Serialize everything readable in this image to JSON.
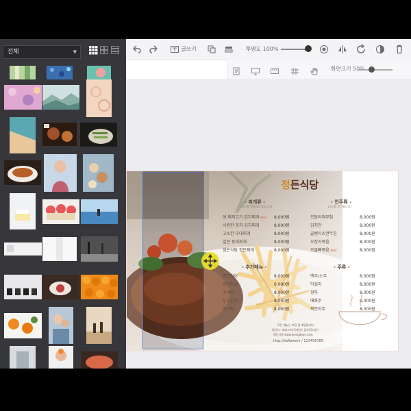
{
  "left_panel": {
    "category": "전체",
    "colors": {
      "panel_bg": "#37373b",
      "select_bg": "#28282c"
    }
  },
  "toolbar": {
    "text_label": "글쓰기",
    "opacity_label": "투명도 100%",
    "opacity_value": 100
  },
  "toolbar2": {
    "zoom_label": "화면크기 50%",
    "zoom_value": 50
  },
  "menu": {
    "title_first": "정",
    "title_rest": "든식당",
    "sections": [
      {
        "title": "- 찌개류 -",
        "subtitle": "(공기밥 포함되어 있습니다)",
        "items": [
          {
            "name": "생 돼지고기 김치찌개",
            "tag": "Best",
            "price": "8,000원"
          },
          {
            "name": "시원한 꽁치 김치찌개",
            "tag": "",
            "price": "8,000원"
          },
          {
            "name": "고소한 부대찌개",
            "tag": "",
            "price": "8,000원"
          },
          {
            "name": "얼큰 동태찌개",
            "tag": "",
            "price": "8,000원"
          },
          {
            "name": "정든식당 정든찌개",
            "tag": "",
            "price": "8,000원"
          }
        ]
      },
      {
        "title": "- 안주류 -",
        "subtitle": "(공기밥 추가됩니다)",
        "items": [
          {
            "name": "모둠야채부침",
            "tag": "",
            "price": "8,000원"
          },
          {
            "name": "김치전",
            "tag": "",
            "price": "8,000원"
          },
          {
            "name": "골뱅이소면무침",
            "tag": "",
            "price": "8,000원"
          },
          {
            "name": "오징어볶음",
            "tag": "",
            "price": "8,000원"
          },
          {
            "name": "오돌뼈볶음",
            "tag": "Best",
            "price": "8,000원"
          }
        ]
      },
      {
        "title": "- 추가메뉴 -",
        "subtitle": "",
        "items": [
          {
            "name": "계란말이",
            "tag": "",
            "price": "8,000원"
          },
          {
            "name": "감자튀김",
            "tag": "",
            "price": "8,000원"
          },
          {
            "name": "소세지",
            "tag": "",
            "price": "8,000원"
          },
          {
            "name": "두부김치",
            "tag": "",
            "price": "8,000원"
          },
          {
            "name": "공기밥",
            "tag": "",
            "price": "8,000원"
          }
        ]
      },
      {
        "title": "- 주류 -",
        "subtitle": "",
        "items": [
          {
            "name": "맥주/소주",
            "tag": "",
            "price": "8,000원"
          },
          {
            "name": "막걸리",
            "tag": "",
            "price": "8,000원"
          },
          {
            "name": "청하",
            "tag": "",
            "price": "8,000원"
          },
          {
            "name": "매화주",
            "tag": "",
            "price": "8,000원"
          },
          {
            "name": "복분자주",
            "tag": "",
            "price": "8,000원"
          }
        ]
      }
    ],
    "footer": [
      "모든 메뉴는 포장 및 배달됩니다.",
      "원산지 : 돼지고기(국내산), 김치(국내산)",
      "정든식당 www.jeongdeun.com",
      "http://hollowork / 123456789"
    ]
  }
}
